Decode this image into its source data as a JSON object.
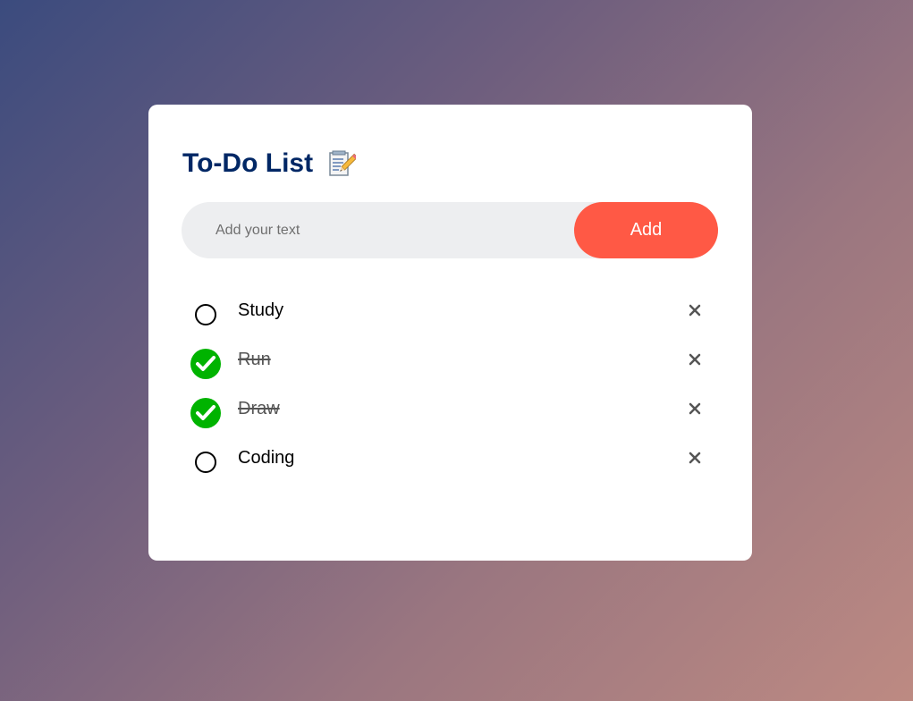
{
  "app": {
    "title": "To-Do List",
    "title_icon": "memo-icon"
  },
  "input": {
    "placeholder": "Add your text",
    "value": ""
  },
  "add_button": {
    "label": "Add"
  },
  "colors": {
    "title": "#002765",
    "accent": "#ff5945",
    "input_bg": "#edeef0",
    "checked": "#00b300"
  },
  "tasks": [
    {
      "label": "Study",
      "checked": false,
      "check_icon": "unchecked-circle-icon",
      "remove_icon": "close-icon"
    },
    {
      "label": "Run",
      "checked": true,
      "check_icon": "checked-circle-icon",
      "remove_icon": "close-icon"
    },
    {
      "label": "Draw",
      "checked": true,
      "check_icon": "checked-circle-icon",
      "remove_icon": "close-icon"
    },
    {
      "label": "Coding",
      "checked": false,
      "check_icon": "unchecked-circle-icon",
      "remove_icon": "close-icon"
    }
  ]
}
